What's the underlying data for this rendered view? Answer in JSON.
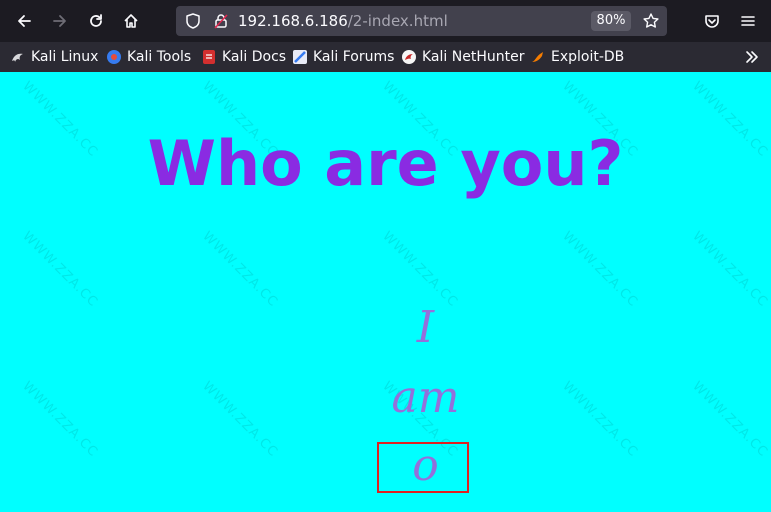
{
  "browser": {
    "url_host": "192.168.6.186",
    "url_path": "/2-index.html",
    "zoom": "80%",
    "icons": [
      "back-icon",
      "forward-icon",
      "reload-icon",
      "home-icon",
      "shield-icon",
      "lock-icon",
      "star-icon",
      "pocket-icon",
      "menu-icon",
      "overflow-chevron-icon"
    ]
  },
  "bookmarks": [
    {
      "label": "Kali Linux",
      "icon": "kali-dragon-icon"
    },
    {
      "label": "Kali Tools",
      "icon": "kali-tools-icon"
    },
    {
      "label": "Kali Docs",
      "icon": "kali-docs-icon"
    },
    {
      "label": "Kali Forums",
      "icon": "kali-forums-icon"
    },
    {
      "label": "Kali NetHunter",
      "icon": "nethunter-icon"
    },
    {
      "label": "Exploit-DB",
      "icon": "exploit-db-icon"
    }
  ],
  "page": {
    "heading": "Who are you?",
    "words": [
      "I",
      "am",
      "o"
    ],
    "watermark": "WWW.ZZA.CC",
    "colors": {
      "background": "#00ffff",
      "heading": "#8a2be2",
      "words": "#9370db",
      "highlight": "#e02020"
    }
  }
}
